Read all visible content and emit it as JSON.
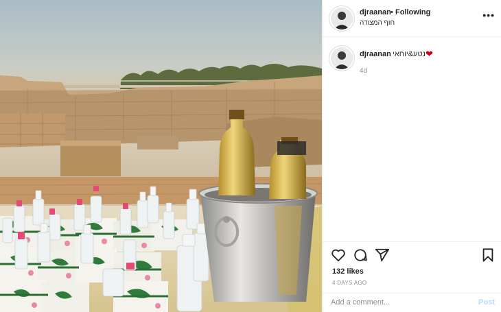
{
  "post": {
    "username": "djraanan",
    "separator": "•",
    "follow_status": "Following",
    "location": "חוף המצודה",
    "more_icon": "more-options-icon"
  },
  "caption": {
    "username": "djraanan",
    "text": "נטע&יוחאי",
    "heart": "❤",
    "time": "4d"
  },
  "actions": {
    "like_icon": "heart-icon",
    "comment_icon": "comment-icon",
    "share_icon": "share-icon",
    "save_icon": "bookmark-icon"
  },
  "likes": "132 likes",
  "posted_ago": "4 DAYS AGO",
  "comment": {
    "placeholder": "Add a comment...",
    "post_label": "Post"
  },
  "colors": {
    "post_button": "#b3dbff",
    "heart": "#d0021b",
    "muted": "#8e8e8e",
    "text": "#262626"
  }
}
